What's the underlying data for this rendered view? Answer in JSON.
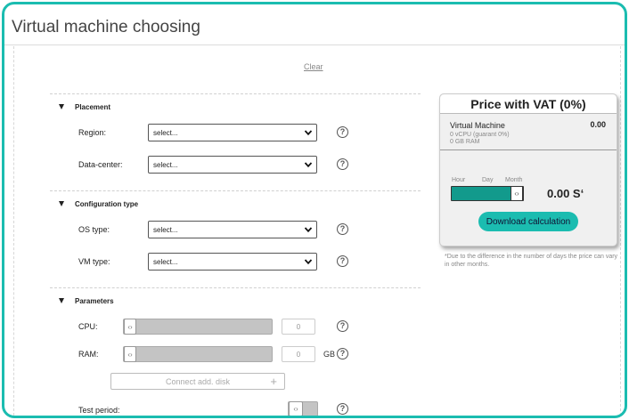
{
  "page": {
    "title": "Virtual machine choosing",
    "clear_label": "Clear"
  },
  "colors": {
    "accent": "#1bbcb0",
    "slider_fill": "#129a8c"
  },
  "placement": {
    "title": "Placement",
    "region": {
      "label": "Region:",
      "value": "select..."
    },
    "datacenter": {
      "label": "Data-center:",
      "value": "select..."
    }
  },
  "config": {
    "title": "Configuration type",
    "os_type": {
      "label": "OS type:",
      "value": "select..."
    },
    "vm_type": {
      "label": "VM type:",
      "value": "select..."
    }
  },
  "parameters": {
    "title": "Parameters",
    "cpu": {
      "label": "CPU:",
      "value": "0"
    },
    "ram": {
      "label": "RAM:",
      "value": "0",
      "unit": "GB"
    },
    "connect_disk": "Connect add. disk",
    "connect_disk_plus": "+",
    "test_period": {
      "label": "Test period:"
    }
  },
  "help_glyph": "?",
  "slider_glyph": "‹›",
  "price": {
    "title": "Price with VAT (0%)",
    "vm_name": "Virtual Machine",
    "vm_price": "0.00",
    "vm_cpu": "0 vCPU (guarant 0%)",
    "vm_ram": "0 GB RAM",
    "periods": [
      "Hour",
      "Day",
      "Month"
    ],
    "selected_period": "Month",
    "total": "0.00 S‘",
    "download_label": "Download calculation"
  },
  "footnote": "*Due to the difference in the number of days the price can vary in other months."
}
